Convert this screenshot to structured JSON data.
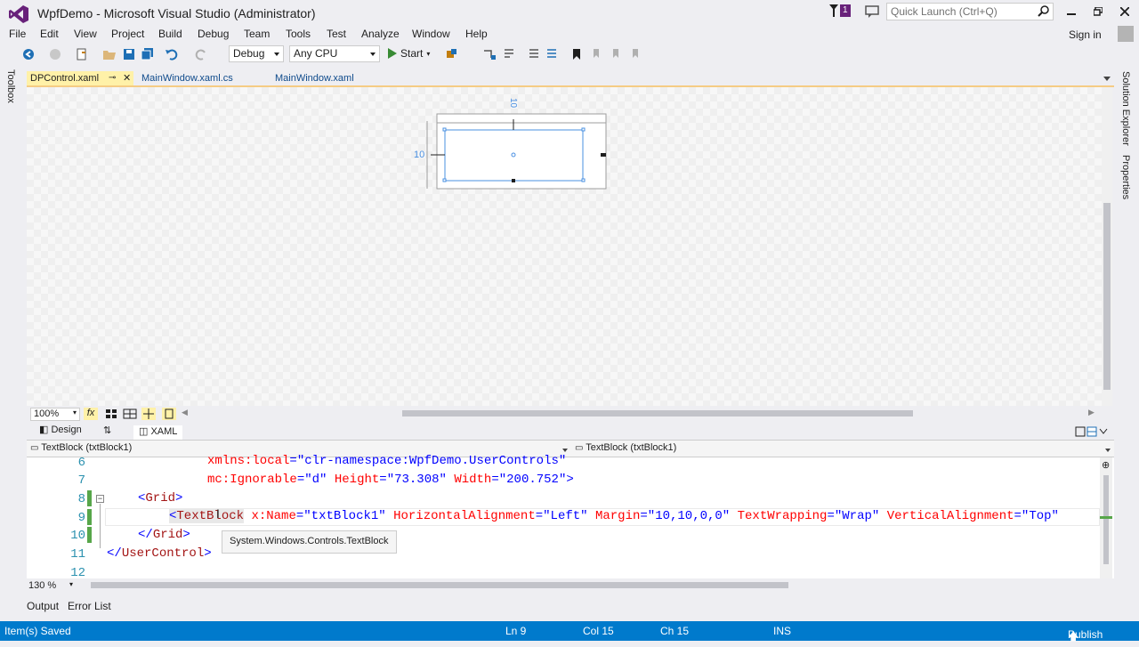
{
  "window": {
    "title": "WpfDemo - Microsoft Visual Studio (Administrator)",
    "notification_count": "1",
    "quick_launch_placeholder": "Quick Launch (Ctrl+Q)"
  },
  "menu": [
    "File",
    "Edit",
    "View",
    "Project",
    "Build",
    "Debug",
    "Team",
    "Tools",
    "Test",
    "Analyze",
    "Window",
    "Help"
  ],
  "account": {
    "sign_in": "Sign in"
  },
  "toolbar": {
    "configuration": "Debug",
    "platform": "Any CPU",
    "start_label": "Start"
  },
  "side": {
    "toolbox": "Toolbox",
    "solution_explorer": "Solution Explorer",
    "properties": "Properties"
  },
  "tabs": [
    {
      "label": "DPControl.xaml",
      "active": true
    },
    {
      "label": "MainWindow.xaml.cs",
      "active": false
    },
    {
      "label": "MainWindow.xaml",
      "active": false
    }
  ],
  "designer": {
    "margin_top_label": "10",
    "margin_left_label": "10",
    "zoom": "100%"
  },
  "split": {
    "design_label": "Design",
    "xaml_label": "XAML"
  },
  "nav": {
    "left": "TextBlock (txtBlock1)",
    "right": "TextBlock (txtBlock1)"
  },
  "code": {
    "line_numbers": [
      "6",
      "7",
      "8",
      "9",
      "10",
      "11",
      "12"
    ],
    "line6_attr": "xmlns:local",
    "line6_eq": "=",
    "line6_val": "\"clr-namespace:WpfDemo.UserControls\"",
    "line7_attr": "mc:Ignorable",
    "line7_val1": "\"d\"",
    "line7_attr2": "Height",
    "line7_val2": "\"73.308\"",
    "line7_attr3": "Width",
    "line7_val3": "\"200.752\"",
    "line7_end": ">",
    "line8_open": "<",
    "line8_tag": "Grid",
    "line8_close": ">",
    "line9_open": "<",
    "line9_tag": "TextBlock",
    "line9_a1": "x:Name",
    "line9_v1": "\"txtBlock1\"",
    "line9_a2": "HorizontalAlignment",
    "line9_v2": "\"Left\"",
    "line9_a3": "Margin",
    "line9_v3": "\"10,10,0,0\"",
    "line9_a4": "TextWrapping",
    "line9_v4": "\"Wrap\"",
    "line9_a5": "VerticalAlignment",
    "line9_v5": "\"Top\"",
    "line10_open": "</",
    "line10_tag": "Grid",
    "line10_close": ">",
    "line11_open": "</",
    "line11_tag": "UserControl",
    "line11_close": ">",
    "tooltip": "System.Windows.Controls.TextBlock",
    "zoom": "130 %"
  },
  "tool_windows": [
    "Output",
    "Error List"
  ],
  "status": {
    "message": "Item(s) Saved",
    "ln": "Ln 9",
    "col": "Col 15",
    "ch": "Ch 15",
    "mode": "INS",
    "publish": "Publish"
  },
  "colors": {
    "accent": "#007acc",
    "vs_purple": "#68217a",
    "active_tab": "#fff1a8"
  }
}
